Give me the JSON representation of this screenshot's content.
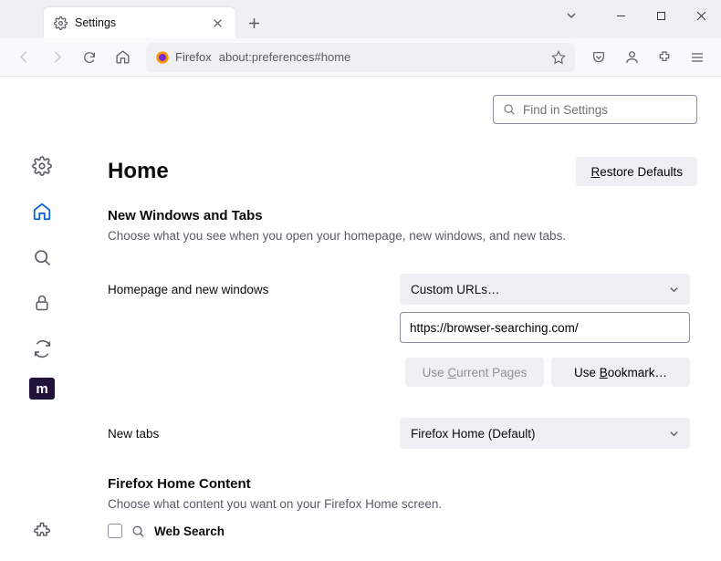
{
  "tab": {
    "title": "Settings"
  },
  "urlbar": {
    "identity": "Firefox",
    "url": "about:preferences#home"
  },
  "search": {
    "placeholder": "Find in Settings"
  },
  "headings": {
    "page": "Home",
    "section1": "New Windows and Tabs",
    "section1_sub": "Choose what you see when you open your homepage, new windows, and new tabs.",
    "section2": "Firefox Home Content",
    "section2_sub": "Choose what content you want on your Firefox Home screen."
  },
  "buttons": {
    "restore": "Restore Defaults",
    "use_current": "Use Current Pages",
    "use_bookmark": "Use Bookmark…"
  },
  "form": {
    "homepage_label": "Homepage and new windows",
    "homepage_select": "Custom URLs…",
    "homepage_url": "https://browser-searching.com/",
    "newtabs_label": "New tabs",
    "newtabs_select": "Firefox Home (Default)"
  },
  "homecontent": {
    "websearch": "Web Search"
  }
}
